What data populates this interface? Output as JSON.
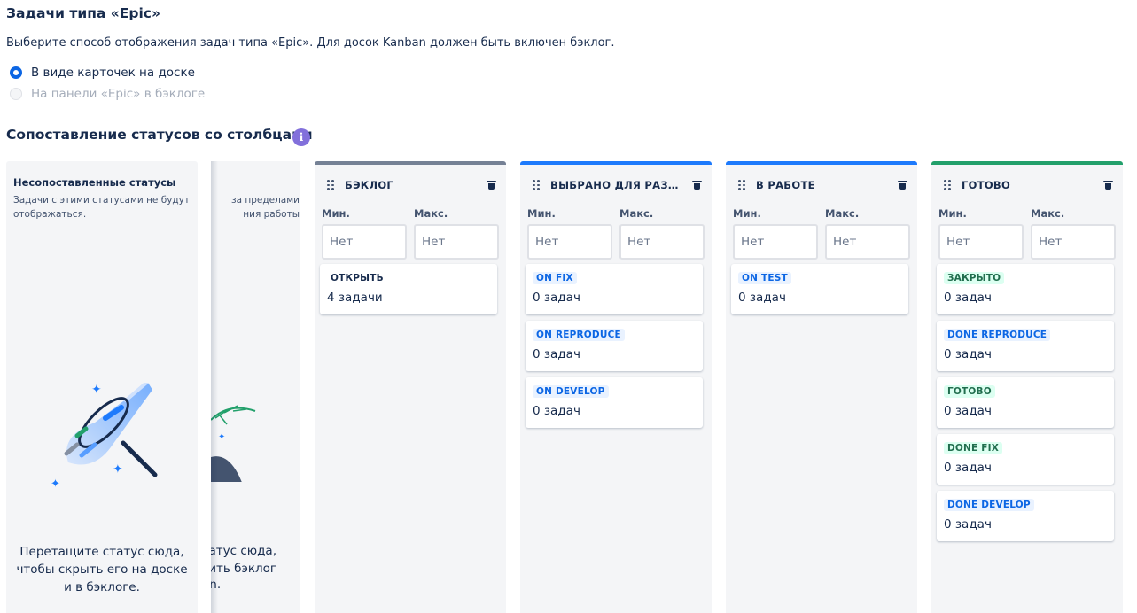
{
  "epic": {
    "title": "Задачи типа «Epic»",
    "description": "Выберите способ отображения задач типа «Epic». Для досок Kanban должен быть включен бэклог.",
    "option_cards": "В виде карточек на доске",
    "option_panel": "На панели «Epic» в бэклоге"
  },
  "mapping": {
    "title": "Сопоставление статусов со столбцами",
    "info_icon": "i"
  },
  "unmapped": {
    "title": "Несопоставленные статусы",
    "subtitle": "Задачи с этими статусами не будут отображаться.",
    "drop_hint": "Перетащите статус сюда, чтобы скрыть его на доске и в бэклоге."
  },
  "backlog_col": {
    "subtitle": "за пределами\nния работы",
    "drop_hint": "статус сюда,\nлить бэклог",
    "drop_tail": "an."
  },
  "columns": [
    {
      "title": "БЭКЛОГ",
      "min_label": "Мин.",
      "max_label": "Макс.",
      "min_placeholder": "Нет",
      "max_placeholder": "Нет",
      "statuses": [
        {
          "name": "ОТКРЫТЬ",
          "count": "4 задачи"
        }
      ]
    },
    {
      "title": "ВЫБРАНО ДЛЯ РАЗР...",
      "min_label": "Мин.",
      "max_label": "Макс.",
      "min_placeholder": "Нет",
      "max_placeholder": "Нет",
      "statuses": [
        {
          "name": "ON FIX",
          "count": "0 задач"
        },
        {
          "name": "ON REPRODUCE",
          "count": "0 задач"
        },
        {
          "name": "ON DEVELOP",
          "count": "0 задач"
        }
      ]
    },
    {
      "title": "В РАБОТЕ",
      "min_label": "Мин.",
      "max_label": "Макс.",
      "min_placeholder": "Нет",
      "max_placeholder": "Нет",
      "statuses": [
        {
          "name": "ON TEST",
          "count": "0 задач"
        }
      ]
    },
    {
      "title": "ГОТОВО",
      "min_label": "Мин.",
      "max_label": "Макс.",
      "min_placeholder": "Нет",
      "max_placeholder": "Нет",
      "statuses": [
        {
          "name": "ЗАКРЫТО",
          "count": "0 задач"
        },
        {
          "name": "DONE REPRODUCE",
          "count": "0 задач"
        },
        {
          "name": "ГОТОВО",
          "count": "0 задач"
        },
        {
          "name": "DONE FIX",
          "count": "0 задач"
        },
        {
          "name": "DONE DEVELOP",
          "count": "0 задач"
        }
      ]
    }
  ],
  "colors": {
    "blue": "#1d7afc",
    "green": "#22a06b",
    "grey": "#758195",
    "info": "#8270db"
  }
}
